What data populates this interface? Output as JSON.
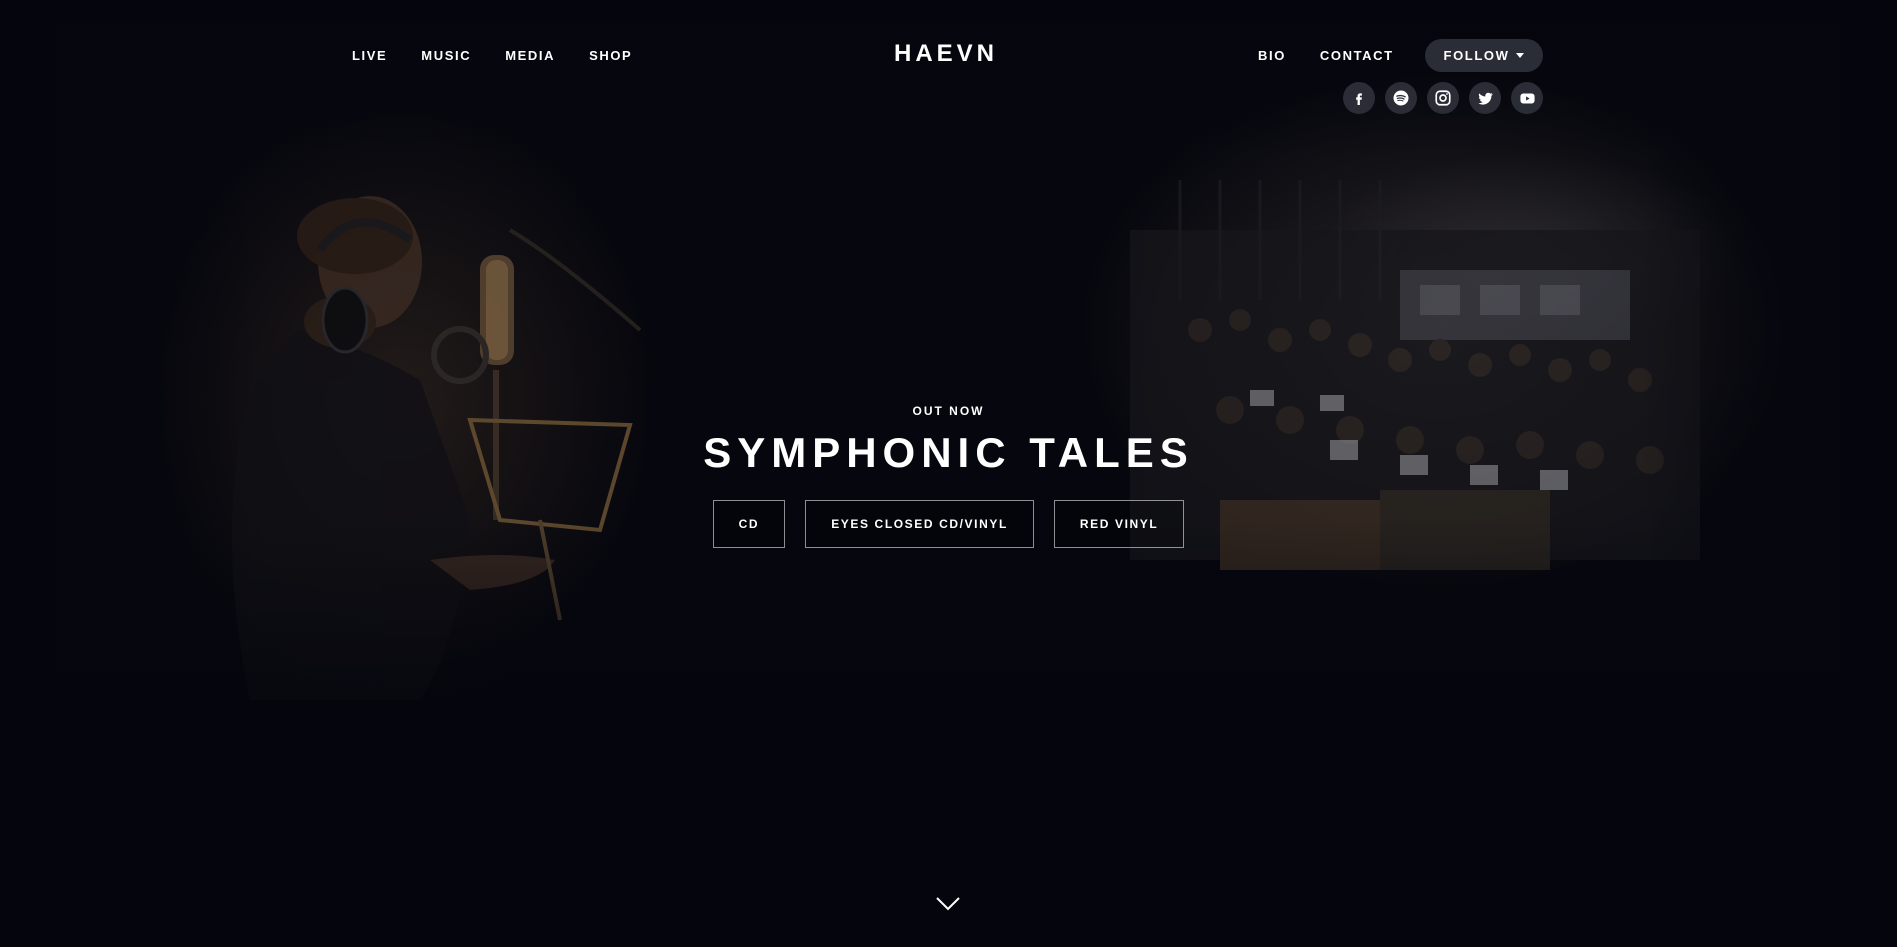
{
  "header": {
    "logo": "HAEVN",
    "nav_left": [
      "LIVE",
      "MUSIC",
      "MEDIA",
      "SHOP"
    ],
    "nav_right": [
      "BIO",
      "CONTACT"
    ],
    "follow_label": "FOLLOW",
    "social_icons": [
      "facebook-icon",
      "spotify-icon",
      "instagram-icon",
      "twitter-icon",
      "youtube-icon"
    ]
  },
  "hero": {
    "eyebrow": "OUT NOW",
    "title": "SYMPHONIC TALES",
    "buttons": [
      "CD",
      "EYES CLOSED CD/VINYL",
      "RED VINYL"
    ],
    "scroll_icon": "chevron-down-icon"
  },
  "colors": {
    "background": "#05060d",
    "pill": "#2a2d36",
    "text": "#ffffff"
  }
}
